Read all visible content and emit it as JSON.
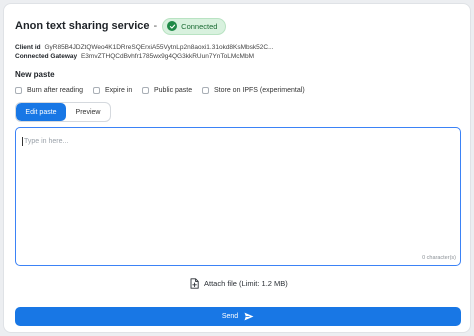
{
  "header": {
    "title": "Anon text sharing service",
    "separator": "-",
    "status": "Connected"
  },
  "client": {
    "client_id_label": "Client id",
    "client_id_value": "GyR85B4JDZtQWeo4K1DRreSQErxiA55VytnLp2n8aoxi1.31okd8KsMbsk52C...",
    "gateway_label": "Connected Gateway",
    "gateway_value": "E3mvZTHQCdBvhfr1785wx9g4QG3kkRUun7YnToLMcMbM"
  },
  "paste": {
    "section_title": "New paste",
    "options": [
      {
        "label": "Burn after reading",
        "checked": false
      },
      {
        "label": "Expire in",
        "checked": false
      },
      {
        "label": "Public paste",
        "checked": false
      },
      {
        "label": "Store on IPFS (experimental)",
        "checked": false
      }
    ],
    "tabs": [
      {
        "label": "Edit paste",
        "active": true
      },
      {
        "label": "Preview",
        "active": false
      }
    ],
    "placeholder": "Type in here...",
    "char_count": "0 character(s)",
    "attach_label": "Attach file (Limit: 1.2 MB)",
    "send_label": "Send"
  }
}
